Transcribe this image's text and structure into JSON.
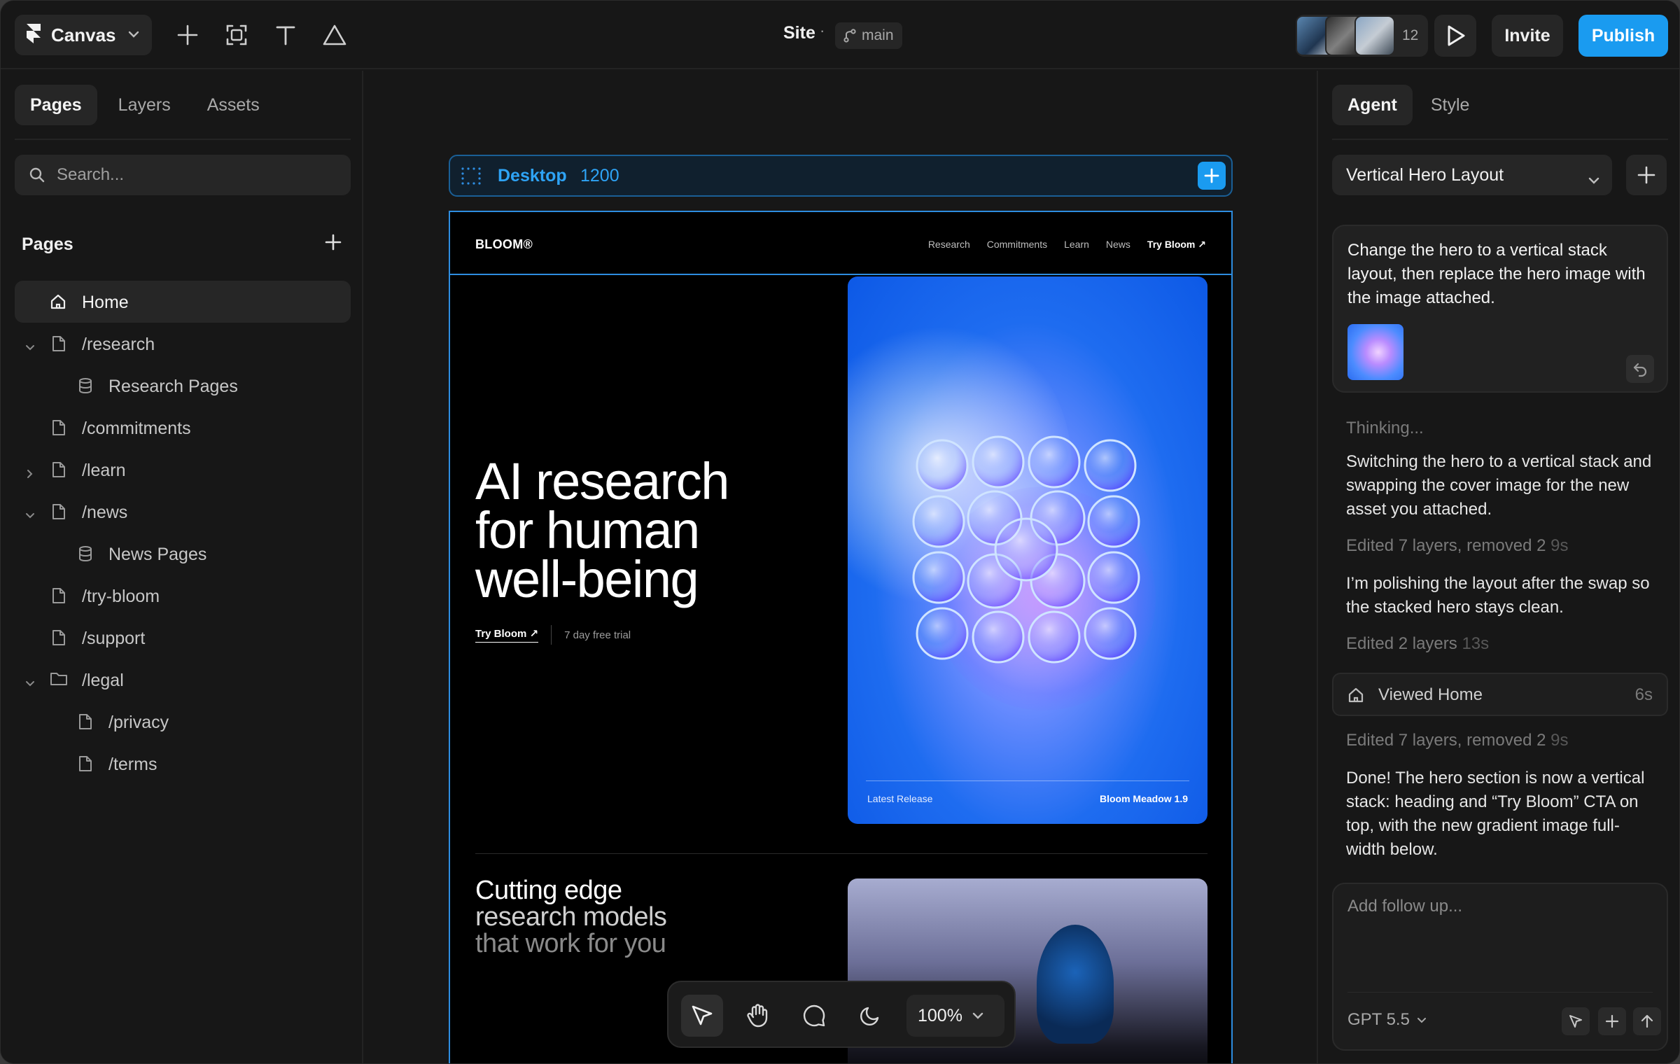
{
  "topbar": {
    "app_menu_label": "Canvas",
    "site_title": "Site",
    "separator": "·",
    "branch": "main",
    "collaborator_count": "12",
    "invite_label": "Invite",
    "publish_label": "Publish",
    "publish_color": "#1a9bf0"
  },
  "left_panel": {
    "tabs": [
      "Pages",
      "Layers",
      "Assets"
    ],
    "active_tab": "Pages",
    "search_placeholder": "Search...",
    "section_title": "Pages",
    "pages": [
      {
        "label": "Home",
        "icon": "home-icon",
        "active": true
      },
      {
        "label": "/research",
        "icon": "page-icon",
        "expanded": true
      },
      {
        "label": "Research Pages",
        "icon": "database-icon"
      },
      {
        "label": "/commitments",
        "icon": "page-icon"
      },
      {
        "label": "/learn",
        "icon": "page-icon",
        "expanded": false
      },
      {
        "label": "/news",
        "icon": "page-icon",
        "expanded": true
      },
      {
        "label": "News Pages",
        "icon": "database-icon"
      },
      {
        "label": "/try-bloom",
        "icon": "page-icon"
      },
      {
        "label": "/support",
        "icon": "page-icon"
      },
      {
        "label": "/legal",
        "icon": "folder-icon",
        "expanded": true
      },
      {
        "label": "/privacy",
        "icon": "page-icon"
      },
      {
        "label": "/terms",
        "icon": "page-icon"
      }
    ]
  },
  "canvas": {
    "frame_name": "Desktop",
    "frame_width": "1200",
    "zoom": "100%",
    "accent": "#2e8de0"
  },
  "site": {
    "logo": "BLOOM®",
    "nav": [
      "Research",
      "Commitments",
      "Learn",
      "News"
    ],
    "nav_cta": "Try Bloom ↗",
    "hero_heading": [
      "AI research",
      "for human",
      "well-being"
    ],
    "hero_cta": "Try Bloom ↗",
    "hero_trial": "7 day free trial",
    "release_label": "Latest Release",
    "release_name": "Bloom Meadow 1.9",
    "section2_heading": [
      "Cutting edge",
      "research models",
      "that work for you"
    ]
  },
  "right_panel": {
    "tabs": [
      "Agent",
      "Style"
    ],
    "active_tab": "Agent",
    "thread_title": "Vertical Hero Layout",
    "prompt": "Change the hero to a vertical stack layout, then replace the hero image with the image attached.",
    "messages": {
      "thinking": "Thinking...",
      "m1": "Switching the hero to a vertical stack and swapping the cover image for the new asset you attached.",
      "e1": "Edited 7 layers, removed 2",
      "e1_time": "9s",
      "m2": "I’m polishing the layout after the swap so the stacked hero stays clean.",
      "e2": "Edited 2 layers",
      "e2_time": "13s",
      "viewed": "Viewed Home",
      "viewed_time": "6s",
      "e3": "Edited 7 layers, removed 2",
      "e3_time": "9s",
      "m3": "Done! The hero section is now a vertical stack: heading and “Try Bloom” CTA on top, with the new gradient image full-width below."
    },
    "composer_placeholder": "Add follow up...",
    "model": "GPT 5.5"
  }
}
